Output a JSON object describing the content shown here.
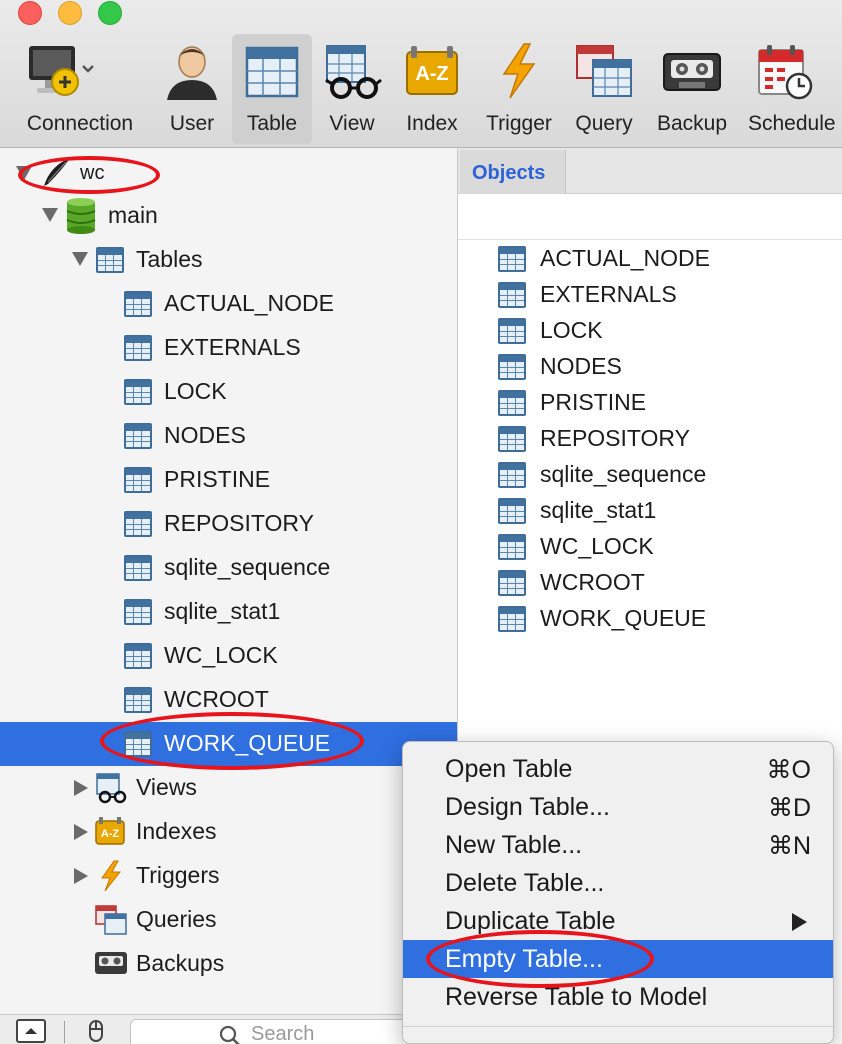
{
  "toolbar": {
    "buttons": [
      {
        "label": "Connection",
        "icon": "connection-icon",
        "active": false
      },
      {
        "label": "User",
        "icon": "user-icon",
        "active": false
      },
      {
        "label": "Table",
        "icon": "table-icon",
        "active": true
      },
      {
        "label": "View",
        "icon": "view-icon",
        "active": false
      },
      {
        "label": "Index",
        "icon": "index-icon",
        "active": false
      },
      {
        "label": "Trigger",
        "icon": "trigger-icon",
        "active": false
      },
      {
        "label": "Query",
        "icon": "query-icon",
        "active": false
      },
      {
        "label": "Backup",
        "icon": "backup-icon",
        "active": false
      },
      {
        "label": "Schedule",
        "icon": "schedule-icon",
        "active": false
      }
    ]
  },
  "sidebar": {
    "connection": {
      "label": "wc",
      "icon": "sqlite-feather-icon"
    },
    "database": {
      "label": "main",
      "icon": "database-icon"
    },
    "tables_group": {
      "label": "Tables"
    },
    "tables": [
      "ACTUAL_NODE",
      "EXTERNALS",
      "LOCK",
      "NODES",
      "PRISTINE",
      "REPOSITORY",
      "sqlite_sequence",
      "sqlite_stat1",
      "WC_LOCK",
      "WCROOT",
      "WORK_QUEUE"
    ],
    "selected_table": "WORK_QUEUE",
    "groups": [
      {
        "label": "Views",
        "icon": "views-icon"
      },
      {
        "label": "Indexes",
        "icon": "indexes-icon"
      },
      {
        "label": "Triggers",
        "icon": "triggers-icon"
      },
      {
        "label": "Queries",
        "icon": "queries-icon"
      },
      {
        "label": "Backups",
        "icon": "backups-icon"
      }
    ]
  },
  "search": {
    "placeholder": "Search"
  },
  "right_pane": {
    "tab": "Objects",
    "objects": [
      "ACTUAL_NODE",
      "EXTERNALS",
      "LOCK",
      "NODES",
      "PRISTINE",
      "REPOSITORY",
      "sqlite_sequence",
      "sqlite_stat1",
      "WC_LOCK",
      "WCROOT",
      "WORK_QUEUE"
    ]
  },
  "context_menu": {
    "items": [
      {
        "label": "Open Table",
        "shortcut": "⌘O"
      },
      {
        "label": "Design Table...",
        "shortcut": "⌘D"
      },
      {
        "label": "New Table...",
        "shortcut": "⌘N"
      },
      {
        "label": "Delete Table...",
        "shortcut": ""
      },
      {
        "label": "Duplicate Table",
        "shortcut": "",
        "submenu": true
      },
      {
        "label": "Empty Table...",
        "shortcut": "",
        "highlighted": true
      },
      {
        "label": "Reverse Table to Model",
        "shortcut": ""
      }
    ]
  },
  "colors": {
    "selection": "#2f6fe0",
    "annotation": "#e8141b",
    "tab_text": "#2d63d8"
  }
}
